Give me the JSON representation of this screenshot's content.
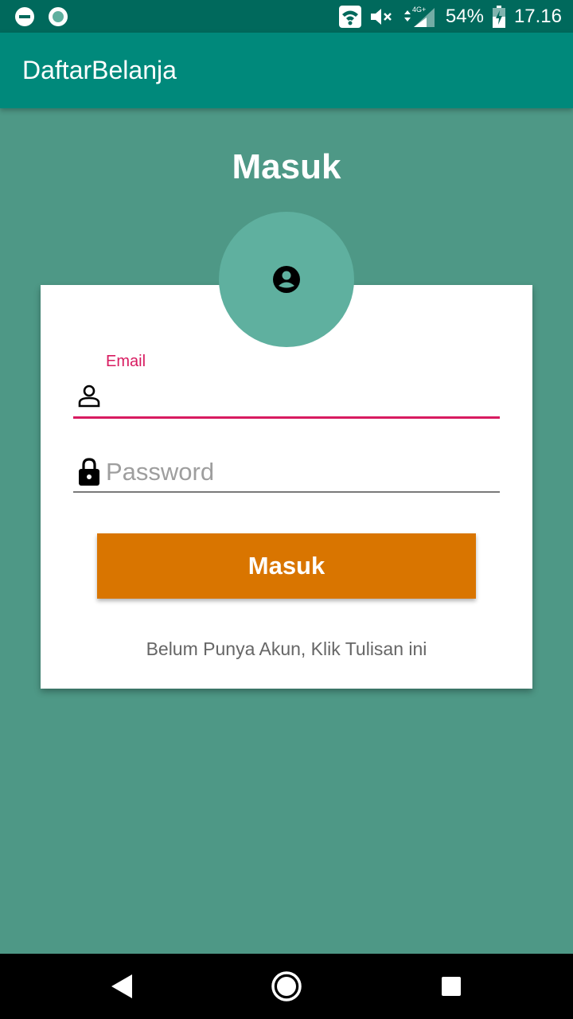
{
  "status_bar": {
    "battery": "54%",
    "time": "17.16",
    "network": "4G+"
  },
  "app_bar": {
    "title": "DaftarBelanja"
  },
  "login": {
    "heading": "Masuk",
    "email_label": "Email",
    "email_value": "",
    "password_placeholder": "Password",
    "password_value": "",
    "submit_label": "Masuk",
    "register_link": "Belum Punya Akun, Klik Tulisan ini"
  },
  "colors": {
    "background": "#4e9886",
    "app_bar": "#00897b",
    "status_bar": "#00695c",
    "accent": "#d81b60",
    "button": "#d97500",
    "avatar": "#5fb09f"
  },
  "icons": {
    "status_left": [
      "do-not-disturb-icon",
      "sync-icon"
    ],
    "status_right": [
      "wifi-icon",
      "volume-off-icon",
      "signal-icon",
      "battery-charging-icon"
    ],
    "avatar": "account-circle-icon",
    "email": "person-outline-icon",
    "password": "lock-icon",
    "nav": [
      "back-icon",
      "home-icon",
      "recents-icon"
    ]
  }
}
